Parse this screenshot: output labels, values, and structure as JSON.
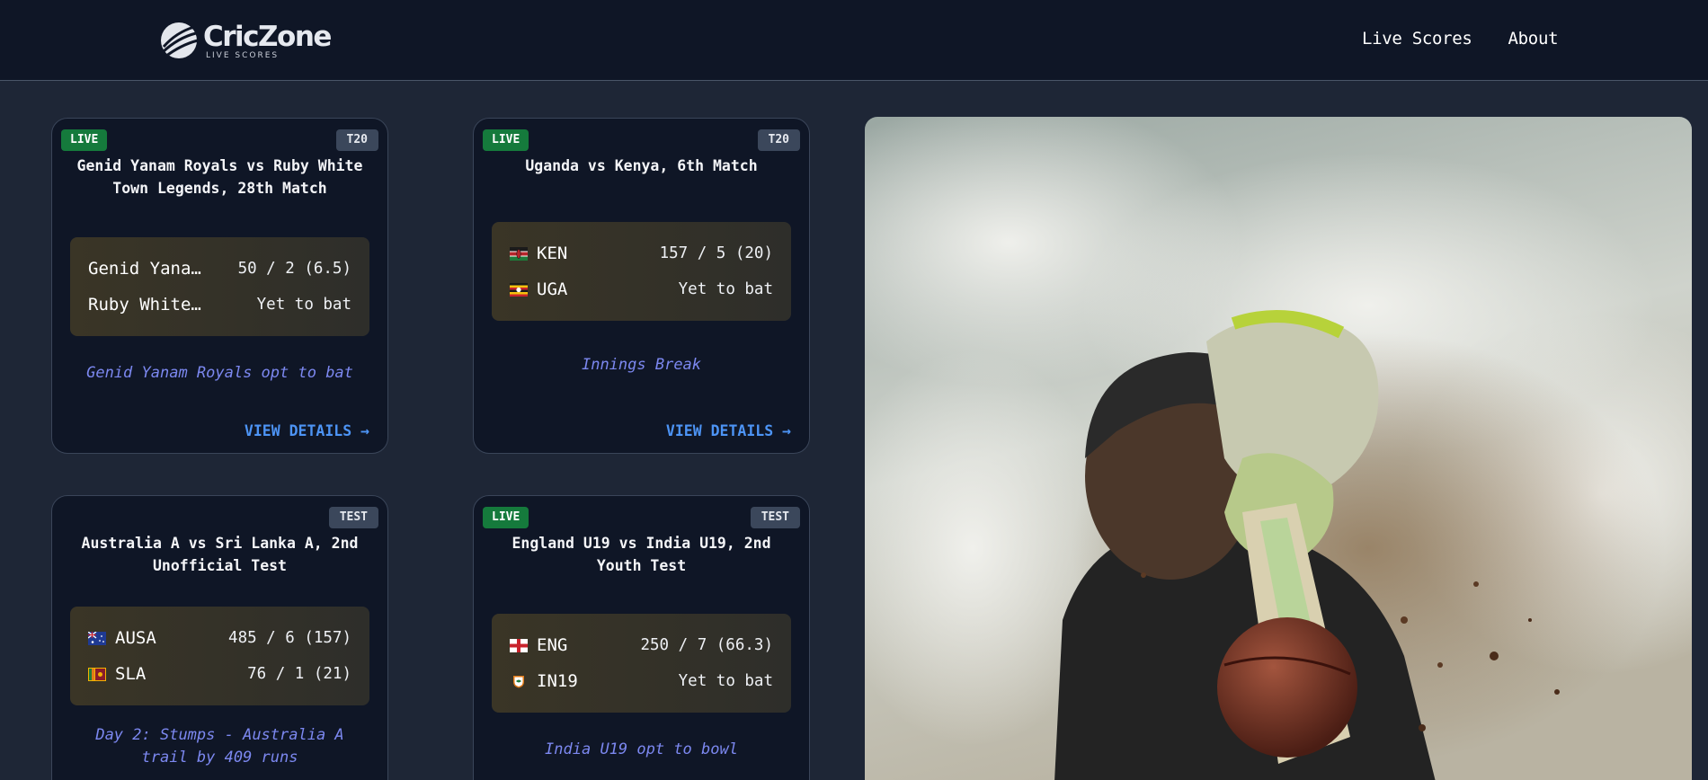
{
  "header": {
    "logo_title": "CricZone",
    "logo_subtitle": "LIVE SCORES",
    "nav": [
      "Live Scores",
      "About"
    ]
  },
  "colors": {
    "header_bg": "#0f1626",
    "page_bg": "#1e2636",
    "live_badge": "#157a3c",
    "status_text": "#7c88f0",
    "link": "#4d94f5"
  },
  "view_details_label": "VIEW DETAILS →",
  "matches": [
    {
      "live": "LIVE",
      "format": "T20",
      "title": "Genid Yanam Royals vs Ruby White Town Legends, 28th Match",
      "teams": [
        {
          "name": "Genid Yana…",
          "flag": "",
          "score": "50 / 2 (6.5)"
        },
        {
          "name": "Ruby White…",
          "flag": "",
          "score": "Yet to bat"
        }
      ],
      "status": "Genid Yanam Royals opt to bat"
    },
    {
      "live": "LIVE",
      "format": "T20",
      "title": "Uganda vs Kenya, 6th Match",
      "teams": [
        {
          "name": "KEN",
          "flag": "kenya-flag-icon",
          "score": "157 / 5 (20)"
        },
        {
          "name": "UGA",
          "flag": "uganda-flag-icon",
          "score": "Yet to bat"
        }
      ],
      "status": "Innings Break"
    },
    {
      "live": "",
      "format": "TEST",
      "title": "Australia A vs Sri Lanka A, 2nd Unofficial Test",
      "teams": [
        {
          "name": "AUSA",
          "flag": "australia-flag-icon",
          "score": "485 / 6 (157)"
        },
        {
          "name": "SLA",
          "flag": "sri-lanka-flag-icon",
          "score": "76 / 1 (21)"
        }
      ],
      "status": "Day 2: Stumps - Australia A trail by 409 runs"
    },
    {
      "live": "LIVE",
      "format": "TEST",
      "title": "England U19 vs India U19, 2nd Youth Test",
      "teams": [
        {
          "name": "ENG",
          "flag": "england-flag-icon",
          "score": "250 / 7 (66.3)"
        },
        {
          "name": "IN19",
          "flag": "india-crest-icon",
          "score": "Yet to bat"
        }
      ],
      "status": "India U19 opt to bowl"
    }
  ],
  "hero_image": "cricket-batsman-photo"
}
